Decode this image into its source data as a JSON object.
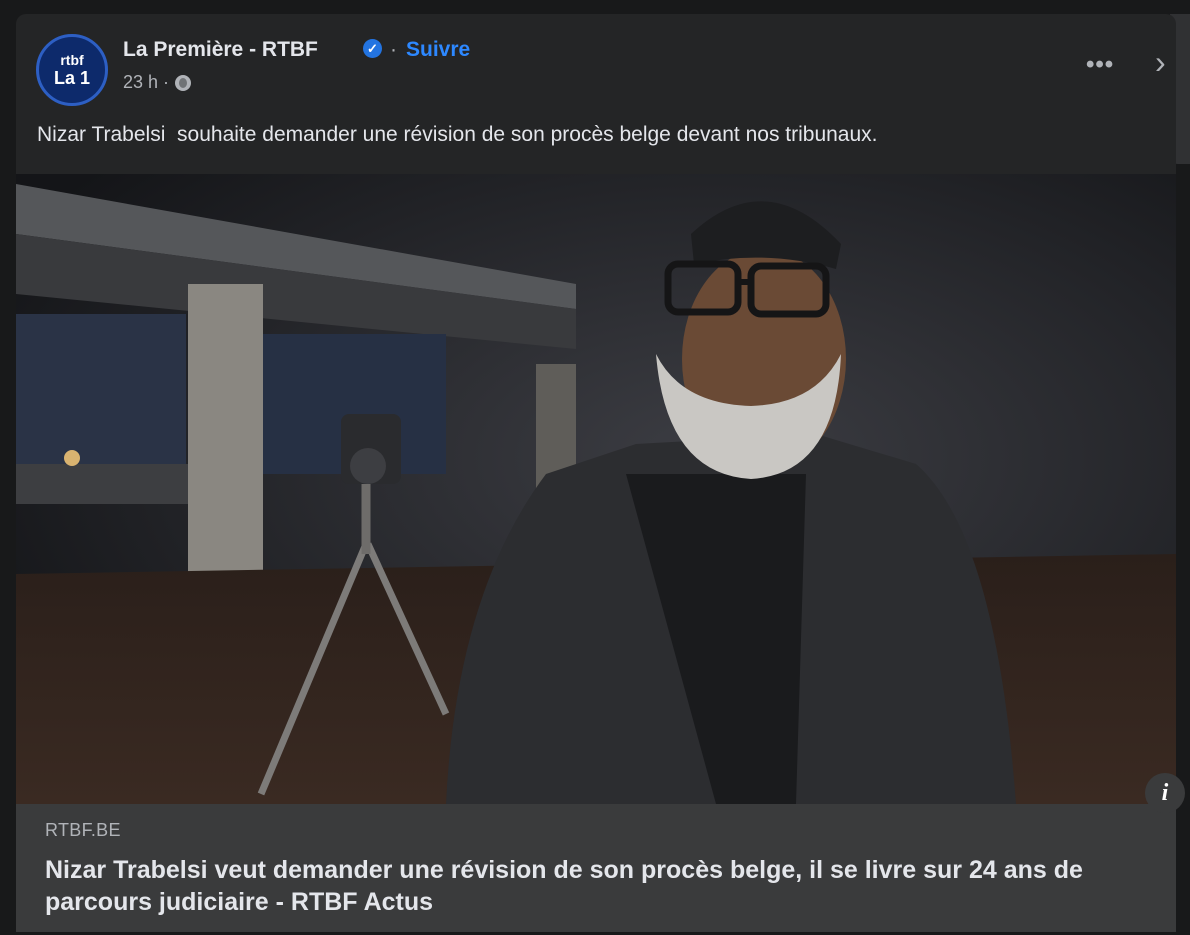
{
  "post": {
    "page_name": "La Première - RTBF",
    "avatar_line1": "rtbf",
    "avatar_line2": "La 1",
    "separator": "·",
    "follow_label": "Suivre",
    "time": "23 h ·",
    "more_label": "•••",
    "next_label": "›",
    "message": "Nizar Trabelsi  souhaite demander une révision de son procès belge devant nos tribunaux."
  },
  "link": {
    "domain": "RTBF.BE",
    "headline": "Nizar Trabelsi veut demander une révision de son procès belge, il se livre sur 24 ans de parcours judiciaire - RTBF Actus",
    "info_label": "i"
  },
  "icons": {
    "verified": "verified-badge-icon",
    "globe": "globe-icon",
    "more": "more-options-icon",
    "chevron": "chevron-right-icon",
    "info": "info-icon"
  },
  "colors": {
    "background": "#18191a",
    "card": "#242526",
    "accent": "#2d88ff",
    "footer": "#3a3b3c"
  }
}
